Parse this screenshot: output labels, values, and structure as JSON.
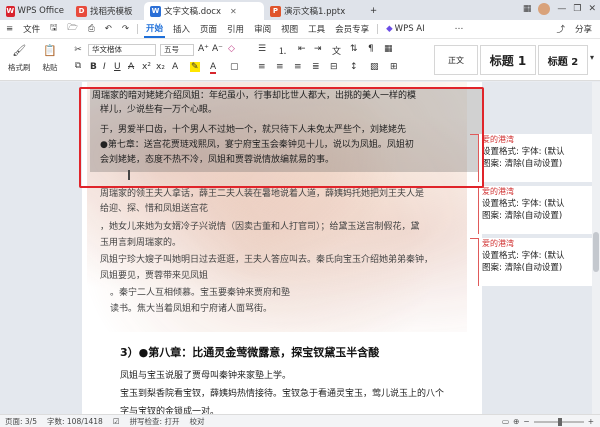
{
  "titlebar": {
    "tabs": [
      {
        "label": "WPS Office",
        "icon": "wps-logo-icon",
        "color": "#d9232d",
        "active": false
      },
      {
        "label": "找稻壳模板",
        "icon": "docer-icon",
        "color": "#e84b3c",
        "active": false
      },
      {
        "label": "文字文稿.docx",
        "icon": "word-doc-icon",
        "color": "#2b6fd6",
        "active": true
      },
      {
        "label": "演示文稿1.pptx",
        "icon": "ppt-doc-icon",
        "color": "#e0542b",
        "active": false
      }
    ],
    "add_tab": "+"
  },
  "menubar": {
    "file": "文件",
    "share": "分享",
    "items": [
      "开始",
      "插入",
      "页面",
      "引用",
      "审阅",
      "视图",
      "工具",
      "会员专享"
    ],
    "active": "开始",
    "ai": "WPS AI"
  },
  "ribbon": {
    "format_painter": "格式刷",
    "paste": "粘贴",
    "font_name": "华文楷体",
    "font_size": "五号",
    "styles": [
      "正文",
      "标题 1",
      "标题 2"
    ]
  },
  "document": {
    "lines": [
      "周瑞家的暗对姥姥介绍凤姐：年纪虽小，行事却比世人都大，出挑的美人一样的模",
      "样儿，少说些有一万个心眼。",
      "于，男爱半口齿，十个男人不过她一个，就只待下人未免太严些个，刘姥姥先",
      "●第七章：送宫花贾琏戏熙凤，宴宁府宝玉会秦钟见十儿，说以为凤姐。凤姐初",
      "会刘姥姥，态度不热不冷，凤姐和贾蓉说情放编就易的事。",
      "周瑞家的领王夫人拿话，薛王二夫人装在暑地说着人道，薛姨妈托她把刘王夫人是",
      "给迎、探、惜和凤姐送宫花",
      "，她女儿来她为女婿冷子兴说情（因卖古董和人打官司）；给黛玉送宫制假花，黛",
      "玉用言刺周瑞家的。",
      "凤姐宁珍大嫂子叫她明日过去逛逛，王夫人答应叫去。秦氏向宝玉介绍她弟弟秦钟，",
      "凤姐要见，贾蓉带来见凤姐",
      "。秦宁二人互相倾慕。宝玉要秦钟来贾府和塾",
      "读书。焦大当着凤姐和宁府诸人面骂街。"
    ],
    "chapter8_heading": "3）●第八章：比通灵金莺微露意，探宝钗黛玉半含酸",
    "chapter8_lines": [
      "凤姐与宝玉说服了贾母叫秦钟来家塾上学。",
      "宝玉到梨香院看宝钗，薛姨妈热情接待。宝钗急于看通灵宝玉，莺儿说玉上的八个",
      "字与宝钗的金锁成一对。"
    ]
  },
  "comments": [
    {
      "author": "爱的港湾",
      "text1": "设置格式: 字体: (默认",
      "text2": "图案: 清除(自动设置)"
    },
    {
      "author": "爱的港湾",
      "text1": "设置格式: 字体: (默认",
      "text2": "图案: 清除(自动设置)"
    },
    {
      "author": "爱的港湾",
      "text1": "设置格式: 字体: (默认",
      "text2": "图案: 清除(自动设置)"
    }
  ],
  "statusbar": {
    "page": "页面: 3/5",
    "words": "字数: 108/1418",
    "spell": "拼写检查: 打开",
    "doc_check": "校对"
  },
  "colors": {
    "accent": "#1e6fd9",
    "annotation_red": "#e0242a",
    "comment_red": "#d03030"
  }
}
